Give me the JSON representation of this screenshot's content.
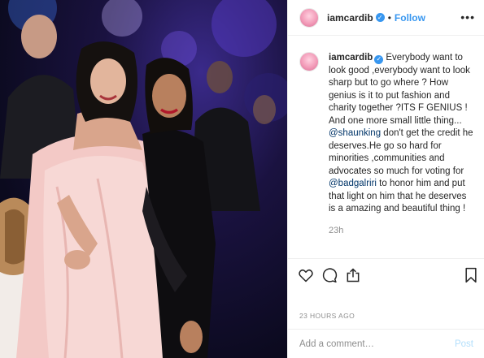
{
  "colors": {
    "accent": "#3897f0",
    "mention": "#003569",
    "muted": "#8e8e8e",
    "post_disabled": "#b2dffc"
  },
  "photo": {
    "subject": "photo"
  },
  "header": {
    "username": "iamcardib",
    "separator": "•",
    "follow_label": "Follow",
    "more_icon": "more-horizontal-icon"
  },
  "caption": {
    "username": "iamcardib",
    "part1": "Everybody want to look good ,everybody want to look sharp but to go where ? How genius is it to put fashion and charity together ?ITS F         GENIUS ! And one more small little thing... ",
    "mention1": "@shaunking",
    "part2": " don't get the credit he deserves.He go so hard for minorities ,communities and advocates so much for voting for ",
    "mention2": "@badgalriri",
    "part3": " to honor him and put that light on him that he deserves is a amazing and beautiful thing !",
    "time": "23h"
  },
  "actions": {
    "like_icon": "heart-icon",
    "comment_icon": "comment-icon",
    "share_icon": "share-icon",
    "save_icon": "bookmark-icon"
  },
  "post_meta": {
    "time_ago": "23 HOURS AGO"
  },
  "comment": {
    "placeholder": "Add a comment…",
    "post_label": "Post"
  }
}
